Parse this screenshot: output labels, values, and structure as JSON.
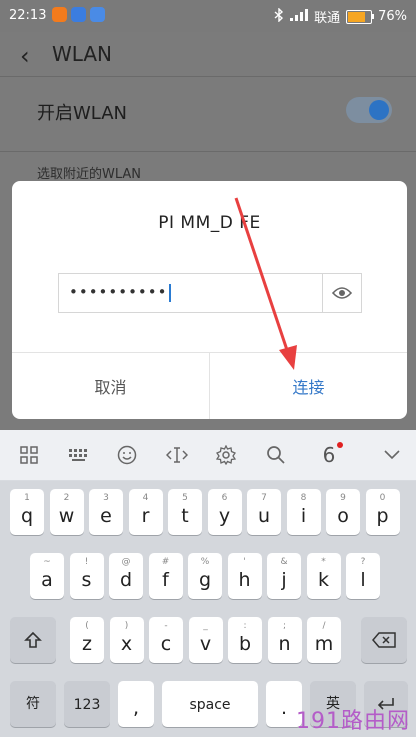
{
  "status_bar": {
    "time": "22:13",
    "carrier": "联通",
    "battery_text": "76%",
    "battery_level": 0.76
  },
  "settings": {
    "title": "WLAN",
    "wlan_toggle_label": "开启WLAN",
    "wlan_enabled": true,
    "section_header": "选取附近的WLAN"
  },
  "dialog": {
    "ssid": "PI        MM_D      FE",
    "password_masked": "••••••••••",
    "cancel_label": "取消",
    "connect_label": "连接",
    "accent_color": "#3478c8"
  },
  "keyboard": {
    "toolbar_candidate": "6",
    "row1": [
      {
        "k": "q",
        "s": "1"
      },
      {
        "k": "w",
        "s": "2"
      },
      {
        "k": "e",
        "s": "3"
      },
      {
        "k": "r",
        "s": "4"
      },
      {
        "k": "t",
        "s": "5"
      },
      {
        "k": "y",
        "s": "6"
      },
      {
        "k": "u",
        "s": "7"
      },
      {
        "k": "i",
        "s": "8"
      },
      {
        "k": "o",
        "s": "9"
      },
      {
        "k": "p",
        "s": "0"
      }
    ],
    "row2": [
      {
        "k": "a",
        "s": "~"
      },
      {
        "k": "s",
        "s": "!"
      },
      {
        "k": "d",
        "s": "@"
      },
      {
        "k": "f",
        "s": "#"
      },
      {
        "k": "g",
        "s": "%"
      },
      {
        "k": "h",
        "s": "'"
      },
      {
        "k": "j",
        "s": "&"
      },
      {
        "k": "k",
        "s": "*"
      },
      {
        "k": "l",
        "s": "?"
      }
    ],
    "row3": [
      {
        "k": "z",
        "s": "("
      },
      {
        "k": "x",
        "s": ")"
      },
      {
        "k": "c",
        "s": "-"
      },
      {
        "k": "v",
        "s": "_"
      },
      {
        "k": "b",
        "s": ":"
      },
      {
        "k": "n",
        "s": ";"
      },
      {
        "k": "m",
        "s": "/"
      }
    ],
    "symbol_label": "符",
    "numbers_label": "123",
    "comma_label": ",",
    "space_label": "space",
    "period_label": ".",
    "chinese_label": "英"
  },
  "watermark": "191路由网"
}
